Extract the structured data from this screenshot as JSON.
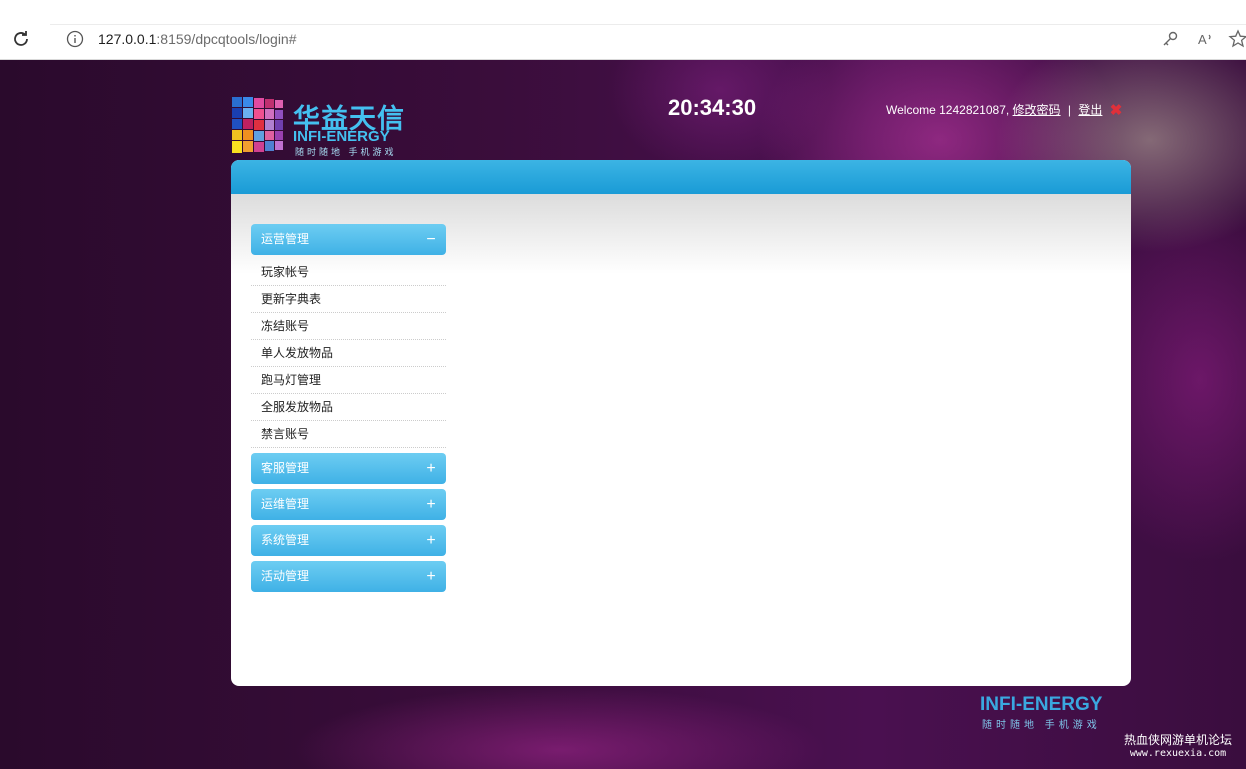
{
  "browser": {
    "url_host": "127.0.0.1",
    "url_rest": ":8159/dpcqtools/login#"
  },
  "header": {
    "logo_cn": "华益天信",
    "logo_en": "INFI-ENERGY",
    "logo_slogan": "随时随地 手机游戏",
    "clock": "20:34:30",
    "welcome": "Welcome 1242821087,",
    "change_password": "修改密码",
    "separator": "|",
    "logout": "登出"
  },
  "sidebar": {
    "groups": [
      {
        "label": "运营管理",
        "toggle": "−",
        "items": [
          "玩家帐号",
          "更新字典表",
          "冻结账号",
          "单人发放物品",
          "跑马灯管理",
          "全服发放物品",
          "禁言账号"
        ]
      },
      {
        "label": "客服管理",
        "toggle": "+"
      },
      {
        "label": "运维管理",
        "toggle": "+"
      },
      {
        "label": "系统管理",
        "toggle": "+"
      },
      {
        "label": "活动管理",
        "toggle": "+"
      }
    ]
  },
  "footer": {
    "logo_en": "INFI-ENERGY",
    "logo_slogan": "随时随地 手机游戏"
  },
  "watermark": {
    "line1": "热血侠网游单机论坛",
    "line2": "www.rexuexia.com"
  }
}
